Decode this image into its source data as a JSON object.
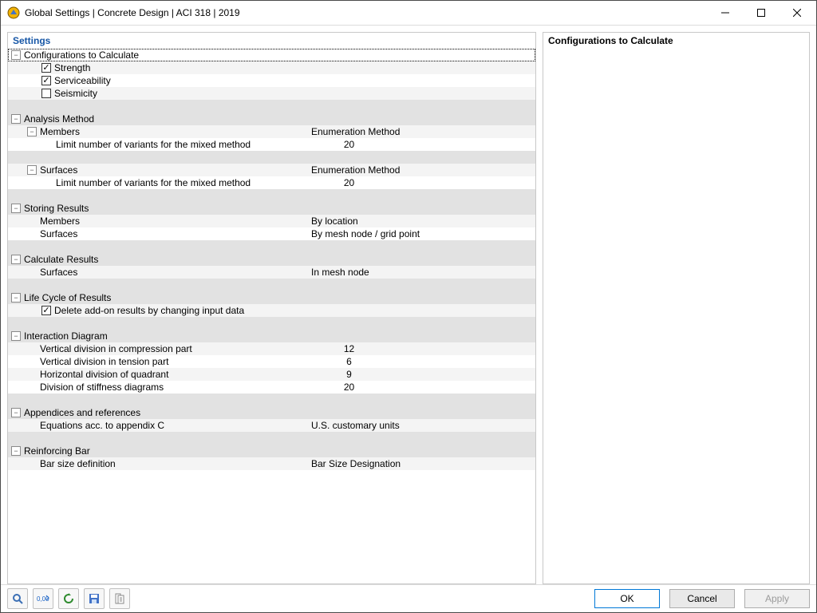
{
  "window": {
    "title": "Global Settings | Concrete Design | ACI 318 | 2019"
  },
  "left_header": "Settings",
  "right_header": "Configurations to Calculate",
  "sections": {
    "config_to_calc": {
      "title": "Configurations to Calculate",
      "strength": "Strength",
      "serviceability": "Serviceability",
      "seismicity": "Seismicity",
      "strength_checked": true,
      "serviceability_checked": true,
      "seismicity_checked": false
    },
    "analysis_method": {
      "title": "Analysis Method",
      "members": "Members",
      "members_value": "Enumeration Method",
      "members_limit_label": "Limit number of variants for the mixed method",
      "members_limit_value": "20",
      "surfaces": "Surfaces",
      "surfaces_value": "Enumeration Method",
      "surfaces_limit_label": "Limit number of variants for the mixed method",
      "surfaces_limit_value": "20"
    },
    "storing_results": {
      "title": "Storing Results",
      "members": "Members",
      "members_value": "By location",
      "surfaces": "Surfaces",
      "surfaces_value": "By mesh node / grid point"
    },
    "calculate_results": {
      "title": "Calculate Results",
      "surfaces": "Surfaces",
      "surfaces_value": "In mesh node"
    },
    "life_cycle": {
      "title": "Life Cycle of Results",
      "delete_label": "Delete add-on results by changing input data",
      "delete_checked": true
    },
    "interaction_diagram": {
      "title": "Interaction Diagram",
      "vdiv_compression": "Vertical division in compression part",
      "vdiv_compression_value": "12",
      "vdiv_tension": "Vertical division in tension part",
      "vdiv_tension_value": "6",
      "hdiv_quadrant": "Horizontal division of quadrant",
      "hdiv_quadrant_value": "9",
      "stiffness_div": "Division of stiffness diagrams",
      "stiffness_div_value": "20"
    },
    "appendices": {
      "title": "Appendices and references",
      "eq_label": "Equations acc. to appendix C",
      "eq_value": "U.S. customary units"
    },
    "reinforcing_bar": {
      "title": "Reinforcing Bar",
      "barsize_label": "Bar size definition",
      "barsize_value": "Bar Size Designation"
    }
  },
  "buttons": {
    "ok": "OK",
    "cancel": "Cancel",
    "apply": "Apply"
  },
  "toolbar_icons": {
    "i1": "search-icon",
    "i2": "precision-icon",
    "i3": "reload-icon",
    "i4": "save-icon",
    "i5": "log-icon"
  }
}
